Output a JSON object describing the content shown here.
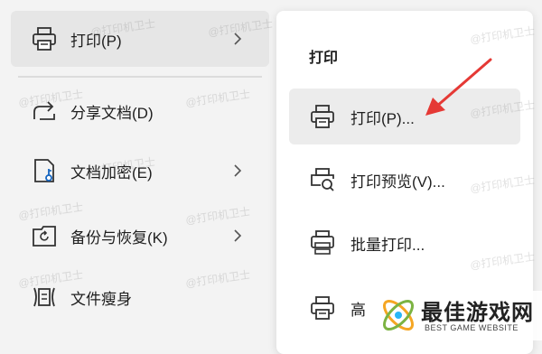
{
  "left_menu": {
    "items": [
      {
        "label": "打印(P)",
        "icon": "printer-icon",
        "has_submenu": true,
        "active": true
      },
      {
        "label": "分享文档(D)",
        "icon": "share-icon",
        "has_submenu": false,
        "active": false
      },
      {
        "label": "文档加密(E)",
        "icon": "document-key-icon",
        "has_submenu": true,
        "active": false
      },
      {
        "label": "备份与恢复(K)",
        "icon": "backup-restore-icon",
        "has_submenu": true,
        "active": false
      },
      {
        "label": "文件瘦身",
        "icon": "compress-file-icon",
        "has_submenu": false,
        "active": false
      }
    ]
  },
  "submenu": {
    "title": "打印",
    "items": [
      {
        "label": "打印(P)...",
        "icon": "printer-icon",
        "hover": true
      },
      {
        "label": "打印预览(V)...",
        "icon": "print-preview-icon",
        "hover": false
      },
      {
        "label": "批量打印...",
        "icon": "batch-print-icon",
        "hover": false
      },
      {
        "label": "高",
        "icon": "printer-icon",
        "hover": false
      }
    ]
  },
  "watermark": {
    "text": "@打印机卫士"
  },
  "logo": {
    "cn_text": "最佳游戏网",
    "en_text": "BEST GAME WEBSITE"
  },
  "colors": {
    "annotation_arrow": "#e53935",
    "active_bg": "#e6e6e6",
    "panel_bg": "#ffffff"
  }
}
